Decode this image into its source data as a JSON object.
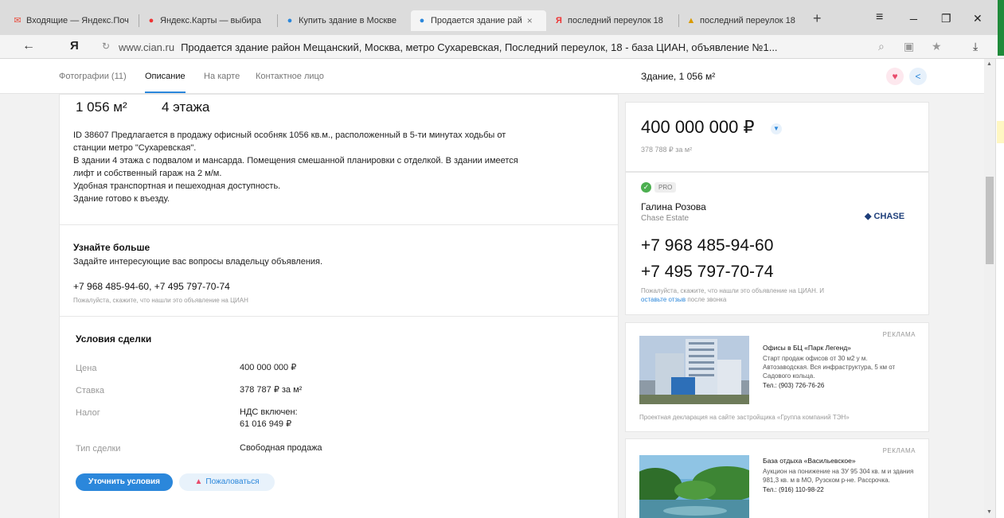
{
  "browser": {
    "tabs": [
      {
        "label": "Входящие — Яндекс.Поч",
        "icon": "mail-icon"
      },
      {
        "label": "Яндекс.Карты — выбира",
        "icon": "yandex-icon"
      },
      {
        "label": "Купить здание в Москве",
        "icon": "pin-icon"
      },
      {
        "label": "Продается здание рай",
        "icon": "pin-icon",
        "active": true
      },
      {
        "label": "последний переулок 18",
        "icon": "yandex-icon"
      },
      {
        "label": "последний переулок 18",
        "icon": "image-icon"
      }
    ],
    "new_tab": "+",
    "controls": {
      "menu": "≡",
      "minimize": "_",
      "restore": "❐",
      "close": "✕"
    },
    "back": "←",
    "logo": "Я",
    "url_domain": "www.cian.ru",
    "url_title": "Продается здание район Мещанский, Москва, метро Сухаревская, Последний переулок, 18 - база ЦИАН, объявление №1..."
  },
  "subnav": {
    "items": [
      "Фотографии (11)",
      "Описание",
      "На карте",
      "Контактное лицо"
    ],
    "active_index": 1,
    "title": "Здание, 1 056 м²"
  },
  "listing": {
    "area": "1 056 м²",
    "floors": "4 этажа",
    "description": [
      "ID 38607 Предлагается в продажу офисный особняк 1056 кв.м., расположенный в 5-ти минутах ходьбы от",
      "станции метро \"Сухаревская\".",
      "В здании 4 этажа с подвалом и мансарда. Помещения смешанной планировки с отделкой. В здании имеется",
      "лифт и собственный гараж на 2 м/м.",
      "Удобная транспортная и пешеходная доступность.",
      "Здание готово к въезду."
    ]
  },
  "learn_more": {
    "title": "Узнайте больше",
    "subtitle": "Задайте интересующие вас вопросы владельцу объявления.",
    "phones": "+7 968 485-94-60, +7 495 797-70-74",
    "note": "Пожалуйста, скажите, что нашли это объявление на ЦИАН"
  },
  "deal": {
    "title": "Условия сделки",
    "rows": [
      {
        "label": "Цена",
        "value": "400 000 000 ₽"
      },
      {
        "label": "Ставка",
        "value": "378 787 ₽ за м²"
      },
      {
        "label": "Налог",
        "value": "НДС включен:",
        "value2": "61 016 949 ₽"
      },
      {
        "label": "Тип сделки",
        "value": "Свободная продажа"
      }
    ],
    "clarify_button": "Уточнить условия",
    "report_button": "Пожаловаться"
  },
  "price_panel": {
    "price": "400 000 000 ₽",
    "per_meter": "378 788 ₽ за м²"
  },
  "agent": {
    "badge": "PRO",
    "name": "Галина Розова",
    "agency": "Chase Estate",
    "agency_logo": "CHASE",
    "phone1": "+7 968 485-94-60",
    "phone2": "+7 495 797-70-74",
    "note_before": "Пожалуйста, скажите, что нашли это объявление на ЦИАН. И ",
    "note_link": "оставьте отзыв",
    "note_after": " после звонка"
  },
  "ads": [
    {
      "label": "РЕКЛАМА",
      "title": "Офисы в БЦ «Парк Легенд»",
      "text": "Старт продаж офисов от 30 м2 у м. Автозаводская. Вся инфраструктура, 5 км от Садового кольца.",
      "phone": "Тел.: (903) 726-76-26",
      "footer": "Проектная декларация на сайте застройщика «Группа компаний ТЭН»"
    },
    {
      "label": "РЕКЛАМА",
      "title": "База отдыха «Васильевское»",
      "text": "Аукцион на понижение на ЗУ 95 304 кв. м и здания 981,3 кв. м в МО, Рузском р-не. Рассрочка.",
      "phone": "Тел.: (916) 110-98-22"
    }
  ],
  "colors": {
    "accent": "#2b87db",
    "heart": "#e94b6c",
    "pro_check": "#4caf50"
  }
}
